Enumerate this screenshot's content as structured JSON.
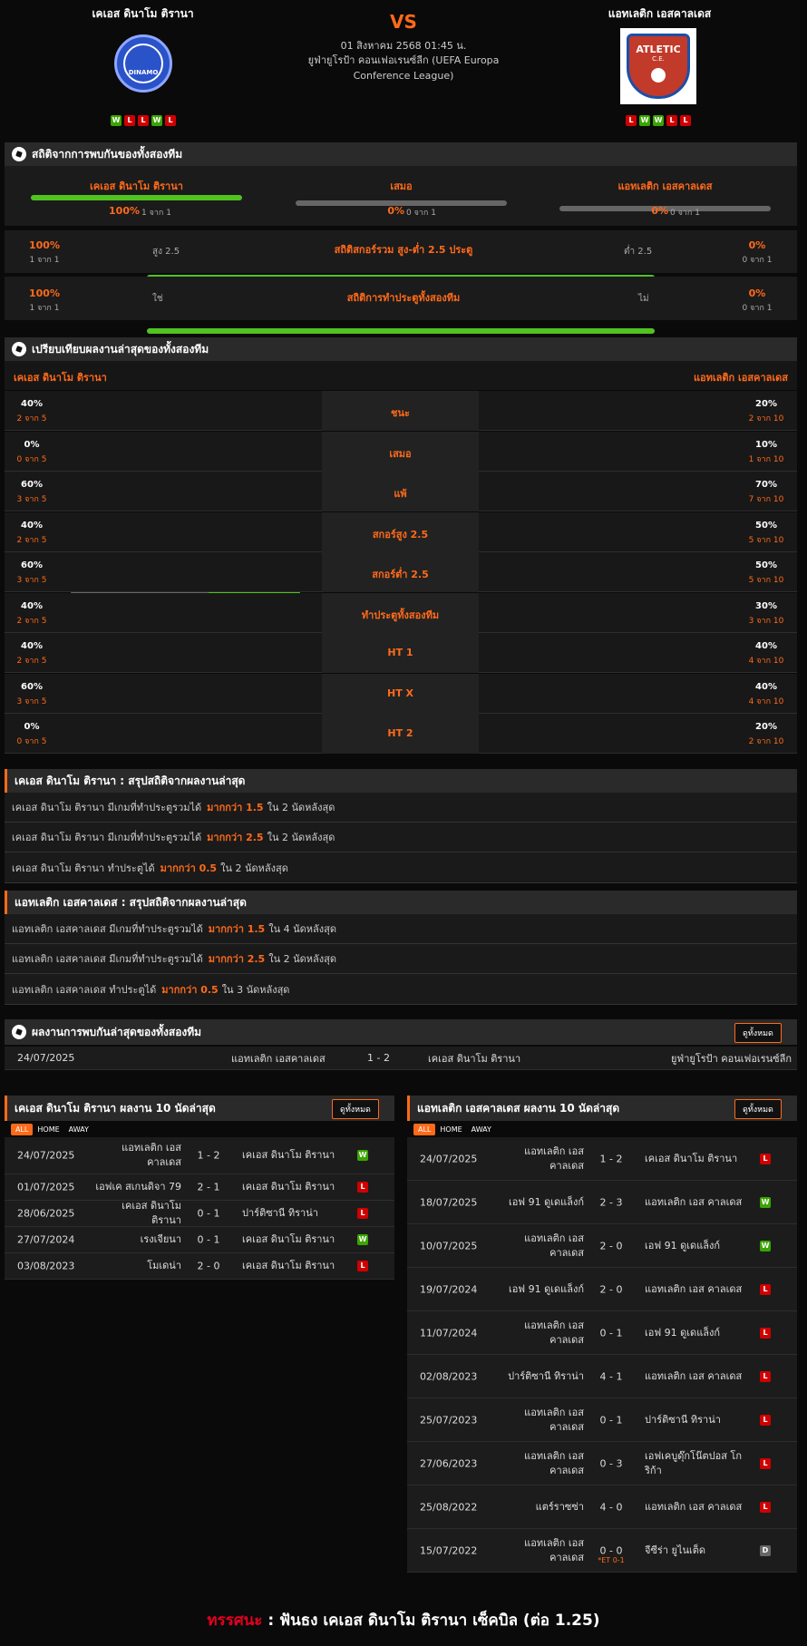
{
  "match": {
    "home": "เคเอส ดินาโม ติรานา",
    "away": "แอทเลติก เอสคาลเดส",
    "vs": "VS",
    "date": "01 สิงหาคม 2568 01:45 น.",
    "league": "ยูฟ่ายูโรป้า คอนเฟอเรนซ์ลีก (UEFA Europa Conference League)",
    "home_form": [
      "W",
      "L",
      "L",
      "W",
      "L"
    ],
    "away_form": [
      "L",
      "W",
      "W",
      "L",
      "L"
    ],
    "away_logo_text": "ATLETIC",
    "away_logo_sub": "C.E.",
    "home_logo_text": "DINAMO"
  },
  "h2h_stats": {
    "title": "สถิติจากการพบกันของทั้งสองทีม",
    "items": [
      {
        "label": "เคเอส ดินาโม ติรานา",
        "pct": "100%",
        "sub": "1 จาก 1",
        "fill": 1
      },
      {
        "label": "เสมอ",
        "pct": "0%",
        "sub": "0 จาก 1",
        "fill": 0
      },
      {
        "label": "แอทเลติก เอสคาลเดส",
        "pct": "0%",
        "sub": "0 จาก 1",
        "fill": 0
      }
    ],
    "ou": {
      "lp": "100%",
      "ls": "1 จาก 1",
      "rp": "0%",
      "rs": "0 จาก 1",
      "left": "สูง 2.5",
      "right": "ต่ำ 2.5",
      "title": "สถิติสกอร์รวม สูง-ต่ำ 2.5 ประตู",
      "fill": 1
    },
    "btts": {
      "lp": "100%",
      "ls": "1 จาก 1",
      "rp": "0%",
      "rs": "0 จาก 1",
      "left": "ใช่",
      "right": "ไม่",
      "title": "สถิติการทำประตูทั้งสองทีม",
      "fill": 1
    }
  },
  "compare": {
    "title": "เปรียบเทียบผลงานล่าสุดของทั้งสองทีม",
    "home": "เคเอส ดินาโม ติรานา",
    "away": "แอทเลติก เอสคาลเดส",
    "rows": [
      {
        "label": "ชนะ",
        "hp": "40%",
        "hs": "2 จาก 5",
        "hf": 0.4,
        "ap": "20%",
        "as": "2 จาก 10",
        "af": 0.2
      },
      {
        "label": "เสมอ",
        "hp": "0%",
        "hs": "0 จาก 5",
        "hf": 0,
        "ap": "10%",
        "as": "1 จาก 10",
        "af": 0.1
      },
      {
        "label": "แพ้",
        "hp": "60%",
        "hs": "3 จาก 5",
        "hf": 0.6,
        "ap": "70%",
        "as": "7 จาก 10",
        "af": 0.7
      },
      {
        "label": "สกอร์สูง 2.5",
        "hp": "40%",
        "hs": "2 จาก 5",
        "hf": 0.4,
        "ap": "50%",
        "as": "5 จาก 10",
        "af": 0.5
      },
      {
        "label": "สกอร์ต่ำ 2.5",
        "hp": "60%",
        "hs": "3 จาก 5",
        "hf": 0.6,
        "ap": "50%",
        "as": "5 จาก 10",
        "af": 0.5
      },
      {
        "label": "ทำประตูทั้งสองทีม",
        "hp": "40%",
        "hs": "2 จาก 5",
        "hf": 0.4,
        "ap": "30%",
        "as": "3 จาก 10",
        "af": 0.3
      },
      {
        "label": "HT 1",
        "hp": "40%",
        "hs": "2 จาก 5",
        "hf": 0.4,
        "ap": "40%",
        "as": "4 จาก 10",
        "af": 0.4
      },
      {
        "label": "HT X",
        "hp": "60%",
        "hs": "3 จาก 5",
        "hf": 0.6,
        "ap": "40%",
        "as": "4 จาก 10",
        "af": 0.4
      },
      {
        "label": "HT 2",
        "hp": "0%",
        "hs": "0 จาก 5",
        "hf": 0,
        "ap": "20%",
        "as": "2 จาก 10",
        "af": 0.2
      }
    ]
  },
  "home_summary": {
    "title": "เคเอส ดินาโม ติรานา : สรุปสถิติจากผลงานล่าสุด",
    "rows": [
      {
        "a": "เคเอส ดินาโม ติรานา  มีเกมที่ทำประตูรวมได้",
        "b": "มากกว่า  1.5",
        "c": "ใน 2 นัดหลังสุด"
      },
      {
        "a": "เคเอส ดินาโม ติรานา  มีเกมที่ทำประตูรวมได้",
        "b": "มากกว่า  2.5",
        "c": "ใน 2 นัดหลังสุด"
      },
      {
        "a": "เคเอส ดินาโม ติรานา  ทำประตูได้",
        "b": "มากกว่า  0.5",
        "c": "ใน 2 นัดหลังสุด"
      }
    ]
  },
  "away_summary": {
    "title": "แอทเลติก เอสคาลเดส : สรุปสถิติจากผลงานล่าสุด",
    "rows": [
      {
        "a": "แอทเลติก เอสคาลเดส  มีเกมที่ทำประตูรวมได้",
        "b": "มากกว่า  1.5",
        "c": "ใน 4 นัดหลังสุด"
      },
      {
        "a": "แอทเลติก เอสคาลเดส  มีเกมที่ทำประตูรวมได้",
        "b": "มากกว่า  2.5",
        "c": "ใน 2 นัดหลังสุด"
      },
      {
        "a": "แอทเลติก เอสคาลเดส  ทำประตูได้",
        "b": "มากกว่า  0.5",
        "c": "ใน 3 นัดหลังสุด"
      }
    ]
  },
  "h2h_results": {
    "title": "ผลงานการพบกันล่าสุดของทั้งสองทีม",
    "button": "ดูทั้งหมด",
    "row": {
      "date": "24/07/2025",
      "home": "แอทเลติก เอสคาลเดส",
      "score": "1 - 2",
      "away": "เคเอส ดินาโม ติรานา",
      "league": "ยูฟ่ายูโรป้า คอนเฟอเรนซ์ลีก"
    }
  },
  "home_last": {
    "title": "เคเอส ดินาโม ติรานา ผลงาน 10 นัดล่าสุด",
    "button": "ดูทั้งหมด",
    "tabs": [
      "ALL",
      "HOME",
      "AWAY"
    ],
    "rows": [
      {
        "date": "24/07/2025",
        "home": "แอทเลติก เอส คาลเดส",
        "score": "1 - 2",
        "away": "เคเอส ดินาโม ติรานา",
        "res": "W"
      },
      {
        "date": "01/07/2025",
        "home": "เอฟเค สเกนดิจา 79",
        "score": "2 - 1",
        "away": "เคเอส ดินาโม ติรานา",
        "res": "L"
      },
      {
        "date": "28/06/2025",
        "home": "เคเอส ดินาโม ติรานา",
        "score": "0 - 1",
        "away": "ปาร์ติซานี ทิราน่า",
        "res": "L"
      },
      {
        "date": "27/07/2024",
        "home": "เรงเจียนา",
        "score": "0 - 1",
        "away": "เคเอส ดินาโม ติรานา",
        "res": "W"
      },
      {
        "date": "03/08/2023",
        "home": "โมเดน่า",
        "score": "2 - 0",
        "away": "เคเอส ดินาโม ติรานา",
        "res": "L"
      }
    ]
  },
  "away_last": {
    "title": "แอทเลติก เอสคาลเดส ผลงาน 10 นัดล่าสุด",
    "button": "ดูทั้งหมด",
    "tabs": [
      "ALL",
      "HOME",
      "AWAY"
    ],
    "rows": [
      {
        "date": "24/07/2025",
        "home": "แอทเลติก เอส คาลเดส",
        "score": "1 - 2",
        "away": "เคเอส ดินาโม ติรานา",
        "res": "L",
        "note": ""
      },
      {
        "date": "18/07/2025",
        "home": "เอฟ 91 ดูเดแล็งก์",
        "score": "2 - 3",
        "away": "แอทเลติก เอส คาลเดส",
        "res": "W",
        "note": ""
      },
      {
        "date": "10/07/2025",
        "home": "แอทเลติก เอส คาลเดส",
        "score": "2 - 0",
        "away": "เอฟ 91 ดูเดแล็งก์",
        "res": "W",
        "note": ""
      },
      {
        "date": "19/07/2024",
        "home": "เอฟ 91 ดูเดแล็งก์",
        "score": "2 - 0",
        "away": "แอทเลติก เอส คาลเดส",
        "res": "L",
        "note": ""
      },
      {
        "date": "11/07/2024",
        "home": "แอทเลติก เอส คาลเดส",
        "score": "0 - 1",
        "away": "เอฟ 91 ดูเดแล็งก์",
        "res": "L",
        "note": ""
      },
      {
        "date": "02/08/2023",
        "home": "ปาร์ติซานี ทิราน่า",
        "score": "4 - 1",
        "away": "แอทเลติก เอส คาลเดส",
        "res": "L",
        "note": ""
      },
      {
        "date": "25/07/2023",
        "home": "แอทเลติก เอส คาลเดส",
        "score": "0 - 1",
        "away": "ปาร์ติซานี ทิราน่า",
        "res": "L",
        "note": ""
      },
      {
        "date": "27/06/2023",
        "home": "แอทเลติก เอส คาลเดส",
        "score": "0 - 3",
        "away": "เอฟเคบูดุ๊กโน๊ตปอส โกริก้า",
        "res": "L",
        "note": ""
      },
      {
        "date": "25/08/2022",
        "home": "แตร์ราซซ่า",
        "score": "4 - 0",
        "away": "แอทเลติก เอส คาลเดส",
        "res": "L",
        "note": ""
      },
      {
        "date": "15/07/2022",
        "home": "แอทเลติก เอส คาลเดส",
        "score": "0 - 0",
        "away": "จีซีร่า ยูไนเต็ด",
        "res": "D",
        "note": "*ET 0-1"
      }
    ]
  },
  "tip": {
    "label": "ทรรศนะ",
    "sep": " : ",
    "text": "ฟันธง เคเอส ดินาโม ติรานา เซ็คบิล (ต่อ 1.25)"
  },
  "colors": {
    "accent": "#ff6a1a",
    "green": "#50c31f",
    "win": "#39a500",
    "loss": "#d00000"
  }
}
